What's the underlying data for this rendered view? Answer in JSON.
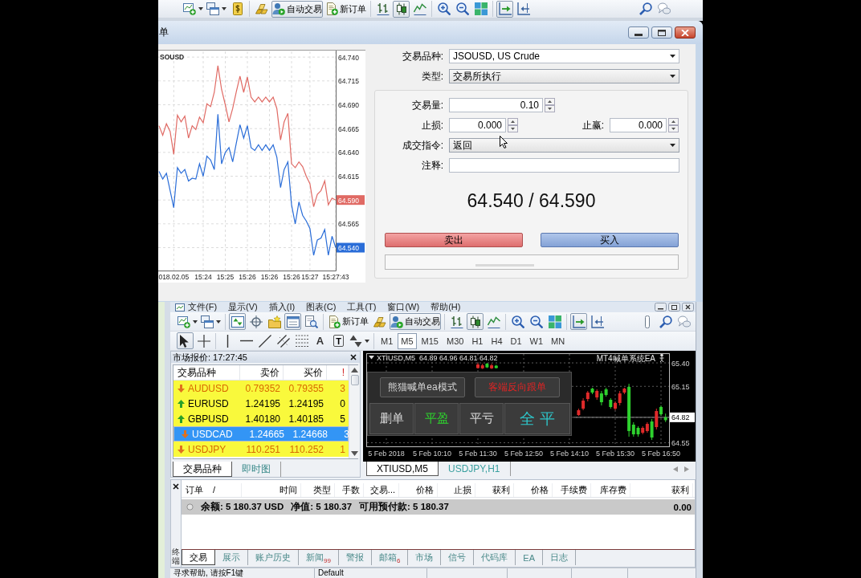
{
  "background_toolbar": {
    "groups": [
      [
        {
          "kind": "icon",
          "pressed": false
        },
        {
          "kind": "icon",
          "pressed": false
        },
        {
          "kind": "icon",
          "pressed": false
        }
      ],
      [
        {
          "kind": "icon",
          "pressed": false
        },
        {
          "kind": "button",
          "label": "自动交易",
          "pressed": true
        },
        {
          "kind": "button",
          "label": "新订单",
          "pressed": false
        }
      ],
      [
        {
          "kind": "icon",
          "pressed": false
        },
        {
          "kind": "icon",
          "pressed": true
        },
        {
          "kind": "icon",
          "pressed": false
        }
      ],
      [
        {
          "kind": "icon",
          "pressed": false
        },
        {
          "kind": "icon",
          "pressed": false
        },
        {
          "kind": "icon",
          "pressed": false
        }
      ],
      [
        {
          "kind": "icon",
          "pressed": true
        },
        {
          "kind": "icon",
          "pressed": false
        }
      ],
      [
        {
          "kind": "icon",
          "pressed": false
        },
        {
          "kind": "icon",
          "pressed": false
        }
      ]
    ]
  },
  "order_dialog": {
    "title": "单",
    "chart": {
      "chart_data": {
        "type": "line",
        "title": "SOUSD",
        "grid": true,
        "categories": [
          null,
          null,
          null,
          null,
          "018.02.05",
          null,
          null,
          null,
          null,
          null,
          null,
          null,
          "15:24",
          null,
          null,
          null,
          null,
          null,
          "15:25",
          null,
          null,
          null,
          null,
          null,
          "15:26",
          null,
          null,
          null,
          null,
          null,
          "15:26",
          null,
          null,
          null,
          null,
          null,
          "15:26",
          null,
          null,
          null,
          null,
          "15:27",
          null,
          null,
          null,
          null,
          null,
          null,
          "15:27:43"
        ],
        "series": [
          {
            "color": "#e06a64",
            "values": [
              64.668,
              64.658,
              64.67,
              64.662,
              64.638,
              64.679,
              64.672,
              64.678,
              64.655,
              64.668,
              64.664,
              64.677,
              64.671,
              64.691,
              64.688,
              64.703,
              64.731,
              64.706,
              64.69,
              64.672,
              64.686,
              64.704,
              64.72,
              64.703,
              64.719,
              64.698,
              64.693,
              64.698,
              64.693,
              64.698,
              64.693,
              64.698,
              64.686,
              64.653,
              64.672,
              64.681,
              64.628,
              64.624,
              64.63,
              64.625,
              64.615,
              64.607,
              64.583,
              64.596,
              64.6,
              64.61,
              64.585,
              64.592,
              64.59
            ]
          },
          {
            "color": "#2a6dd8",
            "values": [
              64.62,
              64.612,
              64.618,
              64.6,
              64.582,
              64.624,
              64.618,
              64.622,
              64.61,
              64.613,
              64.612,
              64.628,
              64.615,
              64.636,
              64.632,
              64.622,
              64.68,
              64.628,
              64.64,
              64.645,
              64.63,
              64.65,
              64.669,
              64.655,
              64.668,
              64.645,
              64.642,
              64.648,
              64.642,
              64.648,
              64.642,
              64.648,
              64.635,
              64.603,
              64.622,
              64.63,
              64.585,
              64.565,
              64.588,
              64.574,
              64.568,
              64.56,
              64.532,
              64.548,
              64.55,
              64.559,
              64.532,
              64.552,
              64.54
            ]
          }
        ],
        "ylim": [
          64.516,
          64.746
        ],
        "yticks": [
          {
            "value": 64.74,
            "label": "64.740"
          },
          {
            "value": 64.715,
            "label": "64.715"
          },
          {
            "value": 64.69,
            "label": "64.690"
          },
          {
            "value": 64.665,
            "label": "64.665"
          },
          {
            "value": 64.64,
            "label": "64.640"
          },
          {
            "value": 64.615,
            "label": "64.615"
          },
          {
            "value": 64.59,
            "label": "64.590"
          },
          {
            "value": 64.565,
            "label": "64.565"
          },
          {
            "value": 64.54,
            "label": "64.540"
          }
        ]
      }
    },
    "form": {
      "symbol": {
        "label": "交易品种:",
        "value": "JSOUSD, US Crude"
      },
      "type": {
        "label": "类型:",
        "value": "交易所执行"
      },
      "volume": {
        "label": "交易量:",
        "value": "0.10"
      },
      "stop_loss": {
        "label": "止损:",
        "value": "0.000"
      },
      "take_profit": {
        "label": "止赢:",
        "value": "0.000"
      },
      "filling": {
        "label": "成交指令:",
        "value": "返回"
      },
      "comment": {
        "label": "注释:"
      },
      "quote": "64.540 / 64.590",
      "sell_button": "卖出",
      "buy_button": "买入"
    }
  },
  "terminal_window": {
    "menu": [
      "文件(F)",
      "显示(V)",
      "插入(I)",
      "图表(C)",
      "工具(T)",
      "窗口(W)",
      "帮助(H)"
    ],
    "toolbar": {
      "groups": [
        [
          {
            "kind": "icon",
            "pressed": false
          },
          {
            "kind": "icon",
            "pressed": false
          }
        ],
        [
          {
            "kind": "icon",
            "pressed": true
          },
          {
            "kind": "icon",
            "pressed": false
          },
          {
            "kind": "icon",
            "pressed": false
          },
          {
            "kind": "icon",
            "pressed": true
          },
          {
            "kind": "icon",
            "pressed": false
          }
        ],
        [
          {
            "kind": "button",
            "label": "新订单",
            "pressed": false
          },
          {
            "kind": "icon",
            "pressed": false
          },
          {
            "kind": "button",
            "label": "自动交易",
            "pressed": true
          }
        ],
        [
          {
            "kind": "icon",
            "pressed": false
          },
          {
            "kind": "icon",
            "pressed": true
          },
          {
            "kind": "icon",
            "pressed": false
          }
        ],
        [
          {
            "kind": "icon",
            "pressed": false
          },
          {
            "kind": "icon",
            "pressed": false
          },
          {
            "kind": "icon",
            "pressed": false
          }
        ],
        [
          {
            "kind": "icon",
            "pressed": true
          },
          {
            "kind": "icon",
            "pressed": false
          }
        ],
        [
          {
            "kind": "icon",
            "pressed": false
          },
          {
            "kind": "icon",
            "pressed": false
          },
          {
            "kind": "icon",
            "pressed": false
          }
        ]
      ]
    },
    "drawing_toolbar": {
      "groups": [
        [
          {
            "kind": "icon",
            "pressed": true
          },
          {
            "kind": "icon",
            "pressed": false
          }
        ],
        [
          {
            "kind": "icon",
            "pressed": false
          },
          {
            "kind": "icon",
            "pressed": false
          },
          {
            "kind": "icon",
            "pressed": false
          },
          {
            "kind": "icon",
            "pressed": false
          },
          {
            "kind": "icon",
            "pressed": false
          },
          {
            "kind": "glyph",
            "label": "A",
            "pressed": false
          },
          {
            "kind": "boxed_glyph",
            "label": "T",
            "pressed": false
          },
          {
            "kind": "icon",
            "pressed": false
          }
        ]
      ],
      "periods": [
        {
          "label": "M1",
          "selected": false
        },
        {
          "label": "M5",
          "selected": true
        },
        {
          "label": "M15",
          "selected": false
        },
        {
          "label": "M30",
          "selected": false
        },
        {
          "label": "H1",
          "selected": false
        },
        {
          "label": "H4",
          "selected": false
        },
        {
          "label": "D1",
          "selected": false
        },
        {
          "label": "W1",
          "selected": false
        },
        {
          "label": "MN",
          "selected": false
        }
      ]
    },
    "market_watch": {
      "title": "市场报价: 17:27:45",
      "columns": [
        "交易品种",
        "卖价",
        "买价",
        "!"
      ],
      "rows": [
        {
          "symbol": "AUDUSD",
          "bid": "0.79352",
          "ask": "0.79355",
          "spread": "3",
          "falling": true,
          "selected": false
        },
        {
          "symbol": "EURUSD",
          "bid": "1.24195",
          "ask": "1.24195",
          "spread": "0",
          "falling": false,
          "selected": false
        },
        {
          "symbol": "GBPUSD",
          "bid": "1.40180",
          "ask": "1.40185",
          "spread": "5",
          "falling": false,
          "selected": false
        },
        {
          "symbol": "USDCAD",
          "bid": "1.24665",
          "ask": "1.24668",
          "spread": "3",
          "falling": true,
          "selected": true
        },
        {
          "symbol": "USDJPY",
          "bid": "110.251",
          "ask": "110.252",
          "spread": "1",
          "falling": true,
          "selected": false
        }
      ],
      "tabs": [
        {
          "label": "交易品种",
          "selected": true
        },
        {
          "label": "即时图",
          "selected": false
        }
      ]
    },
    "chart": {
      "symbol": "XTIUSD,M5",
      "ohlc": "64.89 64.96 64.81 64.82",
      "expert": "MT4喊单系统EA",
      "chart_data": {
        "type": "candlestick",
        "grid": true,
        "categories": [
          "5 Feb 2018",
          null,
          null,
          null,
          null,
          null,
          null,
          null,
          null,
          null,
          "5 Feb 10:10",
          null,
          null,
          null,
          null,
          null,
          null,
          null,
          null,
          null,
          "5 Feb 11:30",
          null,
          null,
          null,
          null,
          null,
          null,
          null,
          null,
          null,
          "5 Feb 12:50",
          null,
          null,
          null,
          null,
          null,
          null,
          null,
          null,
          null,
          "5 Feb 14:10",
          null,
          null,
          null,
          null,
          null,
          null,
          null,
          null,
          null,
          "5 Feb 15:30",
          null,
          null,
          null,
          null,
          null,
          null,
          null,
          null,
          null,
          "5 Feb 16:50",
          null
        ],
        "ohlc": [
          null,
          null,
          null,
          null,
          null,
          null,
          null,
          null,
          null,
          null,
          null,
          null,
          null,
          null,
          null,
          null,
          null,
          null,
          null,
          null,
          [
            65.383,
            65.4,
            65.338,
            65.345
          ],
          [
            65.374,
            65.391,
            65.335,
            65.342
          ],
          [
            65.352,
            65.4,
            65.345,
            65.391
          ],
          [
            65.374,
            65.391,
            65.335,
            65.342
          ],
          [
            65.345,
            65.38,
            65.34,
            65.37
          ],
          null,
          null,
          null,
          null,
          null,
          null,
          null,
          null,
          null,
          null,
          null,
          null,
          null,
          null,
          null,
          null,
          null,
          [
            64.896,
            64.913,
            64.836,
            64.844
          ],
          [
            64.998,
            65.024,
            64.896,
            64.913
          ],
          [
            65.084,
            65.101,
            64.99,
            65.015
          ],
          [
            65.084,
            65.135,
            65.067,
            65.126
          ],
          [
            65.101,
            65.118,
            65.007,
            65.032
          ],
          [
            64.981,
            65.101,
            64.947,
            65.075
          ],
          [
            65.058,
            65.135,
            65.041,
            65.118
          ],
          [
            64.93,
            65.024,
            64.913,
            65.007
          ],
          [
            64.973,
            64.99,
            64.896,
            64.913
          ],
          [
            65.075,
            65.101,
            64.947,
            64.973
          ],
          [
            65.126,
            65.135,
            65.067,
            65.084
          ],
          [
            64.674,
            65.178,
            64.614,
            65.144
          ],
          [
            64.639,
            64.768,
            64.614,
            64.742
          ],
          [
            64.639,
            64.725,
            64.614,
            64.708
          ],
          [
            64.708,
            64.725,
            64.639,
            64.656
          ],
          [
            64.75,
            64.768,
            64.656,
            64.674
          ],
          [
            64.605,
            64.802,
            64.579,
            64.776
          ],
          [
            64.887,
            64.913,
            64.691,
            64.716
          ],
          [
            64.853,
            64.947,
            64.836,
            64.93
          ],
          [
            64.79,
            64.86,
            64.77,
            64.82
          ]
        ],
        "ylim": [
          64.511,
          65.503
        ],
        "yticks": [
          {
            "value": 65.4,
            "label": "65.40"
          },
          {
            "value": 65.15,
            "label": "65.15"
          },
          {
            "value": 64.82,
            "label": "64.82"
          },
          {
            "value": 64.55,
            "label": "64.55"
          }
        ]
      },
      "ea_panel": {
        "top_buttons": [
          {
            "label": "熊猫喊单ea模式",
            "color": "#d6d6d6"
          },
          {
            "label": "客端反向跟单",
            "color": "#e02424"
          }
        ],
        "bottom_buttons": [
          {
            "label": "删单",
            "color": "#d6d6d6"
          },
          {
            "label": "平盈",
            "color": "#2ed12e"
          },
          {
            "label": "平亏",
            "color": "#d6d6d6"
          },
          {
            "label": "全 平",
            "color": "#2ec4c8"
          }
        ]
      }
    },
    "chart_tabs": [
      {
        "label": "XTIUSD,M5",
        "selected": true
      },
      {
        "label": "USDJPY,H1",
        "selected": false
      }
    ],
    "terminal": {
      "title": "终端",
      "sort_indicator": "/",
      "columns": [
        "订单",
        "时间",
        "类型",
        "手数",
        "交易...",
        "价格",
        "止损",
        "获利",
        "价格",
        "手续费",
        "库存费",
        "获利"
      ],
      "balance": [
        "余额: 5 180.37 USD",
        "净值: 5 180.37",
        "可用预付款: 5 180.37"
      ],
      "profit": "0.00",
      "tabs": [
        {
          "label": "交易",
          "selected": true
        },
        {
          "label": "展示",
          "selected": false
        },
        {
          "label": "账户历史",
          "selected": false
        },
        {
          "label": "新闻",
          "badge": "99",
          "selected": false
        },
        {
          "label": "警报",
          "selected": false
        },
        {
          "label": "邮箱",
          "badge": "6",
          "selected": false
        },
        {
          "label": "市场",
          "selected": false
        },
        {
          "label": "信号",
          "selected": false
        },
        {
          "label": "代码库",
          "selected": false
        },
        {
          "label": "EA",
          "selected": false
        },
        {
          "label": "日志",
          "selected": false
        }
      ]
    },
    "status_bar": [
      "寻求帮助, 请按F1键",
      "Default"
    ]
  }
}
